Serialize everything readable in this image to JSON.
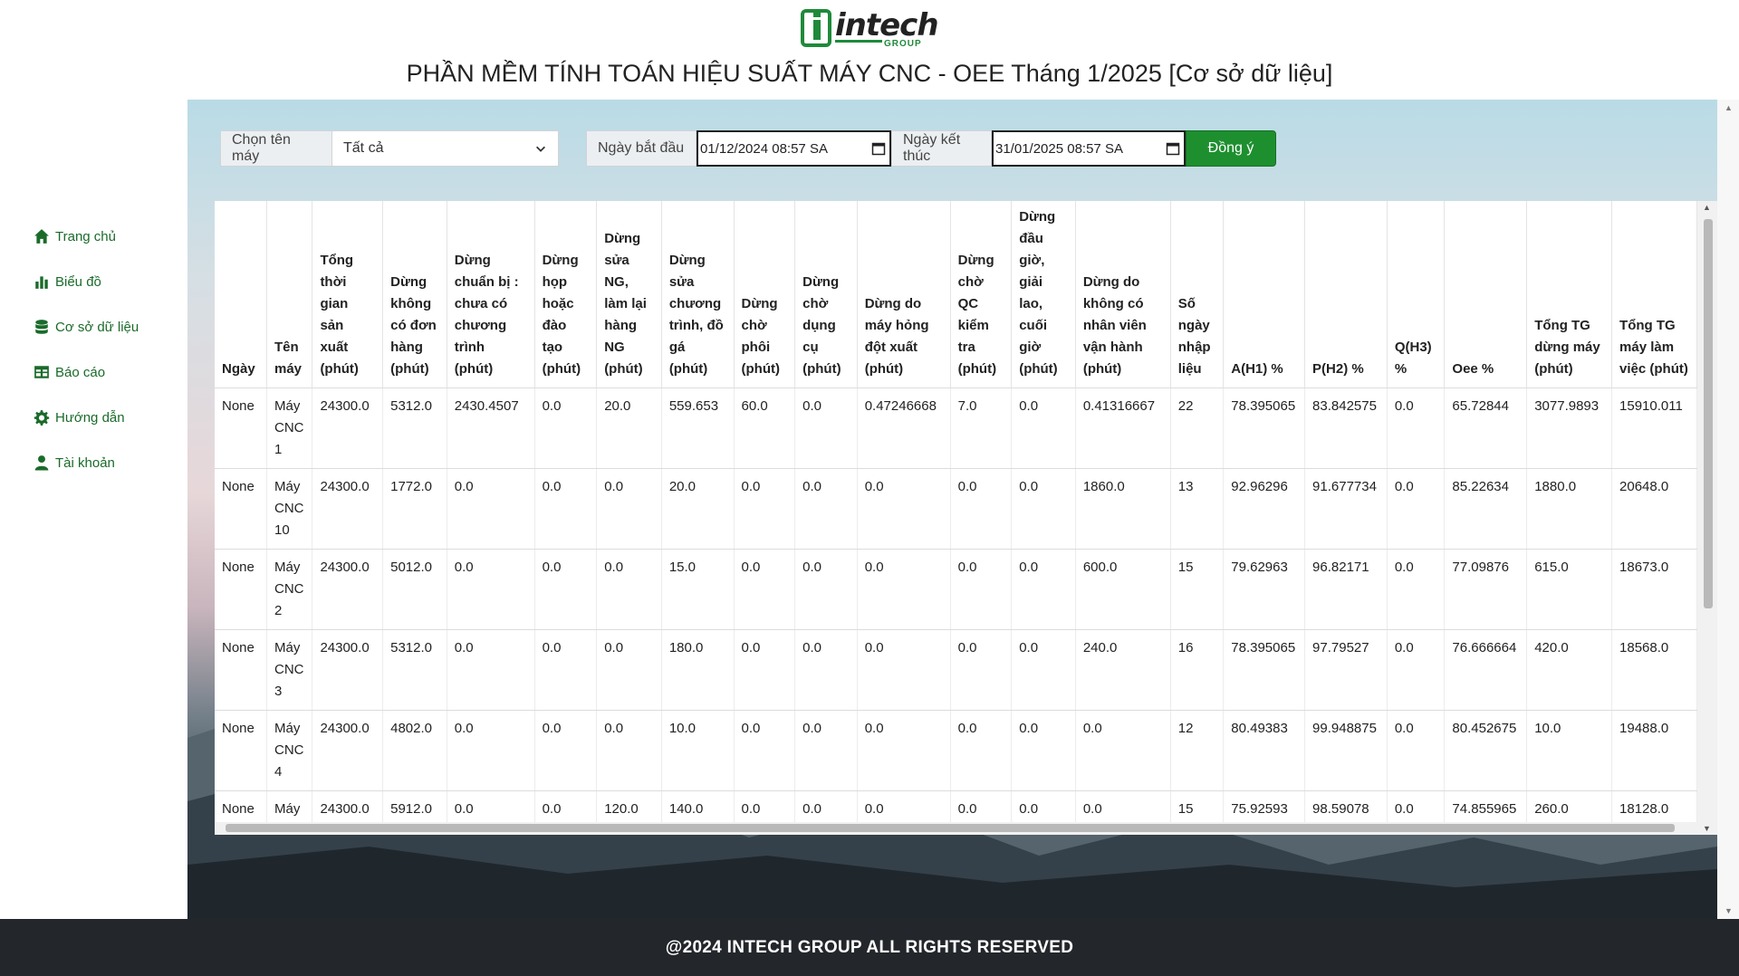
{
  "logo": {
    "text": "intech",
    "sub": "GROUP"
  },
  "page_title": "PHẦN MỀM TÍNH TOÁN HIỆU SUẤT MÁY CNC - OEE Tháng 1/2025 [Cơ sở dữ liệu]",
  "sidebar": {
    "items": [
      {
        "label": "Trang chủ",
        "icon": "home-icon"
      },
      {
        "label": "Biểu đồ",
        "icon": "bar-chart-icon"
      },
      {
        "label": "Cơ sở dữ liệu",
        "icon": "database-icon"
      },
      {
        "label": "Báo cáo",
        "icon": "table-icon"
      },
      {
        "label": "Hướng dẫn",
        "icon": "gear-icon"
      },
      {
        "label": "Tài khoản",
        "icon": "user-icon"
      }
    ]
  },
  "filters": {
    "machine_label": "Chọn tên máy",
    "machine_value": "Tất cả",
    "start_label": "Ngày bắt đầu",
    "start_value": "01/12/2024 08:57  SA",
    "end_label": "Ngày kết thúc",
    "end_value": "31/01/2025 08:57  SA",
    "submit_label": "Đồng ý"
  },
  "table": {
    "headers": [
      "Ngày",
      "Tên máy",
      "Tổng thời gian sản xuất (phút)",
      "Dừng không có đơn hàng (phút)",
      "Dừng chuẩn bị : chưa có chương trình (phút)",
      "Dừng họp hoặc đào tạo (phút)",
      "Dừng sửa NG, làm lại hàng NG (phút)",
      "Dừng sửa chương trình, đồ gá (phút)",
      "Dừng chờ phôi (phút)",
      "Dừng chờ dụng cụ (phút)",
      "Dừng do máy hỏng đột xuất (phút)",
      "Dừng chờ QC kiểm tra (phút)",
      "Dừng đầu giờ, giải lao, cuối giờ (phút)",
      "Dừng do không có nhân viên vận hành (phút)",
      "Số ngày nhập liệu",
      "A(H1) %",
      "P(H2) %",
      "Q(H3) %",
      "Oee %",
      "Tổng TG dừng máy (phút)",
      "Tổng TG máy làm việc (phút)"
    ],
    "rows": [
      [
        "None",
        "Máy CNC 1",
        "24300.0",
        "5312.0",
        "2430.4507",
        "0.0",
        "20.0",
        "559.653",
        "60.0",
        "0.0",
        "0.47246668",
        "7.0",
        "0.0",
        "0.41316667",
        "22",
        "78.395065",
        "83.842575",
        "0.0",
        "65.72844",
        "3077.9893",
        "15910.011"
      ],
      [
        "None",
        "Máy CNC 10",
        "24300.0",
        "1772.0",
        "0.0",
        "0.0",
        "0.0",
        "20.0",
        "0.0",
        "0.0",
        "0.0",
        "0.0",
        "0.0",
        "1860.0",
        "13",
        "92.96296",
        "91.677734",
        "0.0",
        "85.22634",
        "1880.0",
        "20648.0"
      ],
      [
        "None",
        "Máy CNC 2",
        "24300.0",
        "5012.0",
        "0.0",
        "0.0",
        "0.0",
        "15.0",
        "0.0",
        "0.0",
        "0.0",
        "0.0",
        "0.0",
        "600.0",
        "15",
        "79.62963",
        "96.82171",
        "0.0",
        "77.09876",
        "615.0",
        "18673.0"
      ],
      [
        "None",
        "Máy CNC 3",
        "24300.0",
        "5312.0",
        "0.0",
        "0.0",
        "0.0",
        "180.0",
        "0.0",
        "0.0",
        "0.0",
        "0.0",
        "0.0",
        "240.0",
        "16",
        "78.395065",
        "97.79527",
        "0.0",
        "76.666664",
        "420.0",
        "18568.0"
      ],
      [
        "None",
        "Máy CNC 4",
        "24300.0",
        "4802.0",
        "0.0",
        "0.0",
        "0.0",
        "10.0",
        "0.0",
        "0.0",
        "0.0",
        "0.0",
        "0.0",
        "0.0",
        "12",
        "80.49383",
        "99.948875",
        "0.0",
        "80.452675",
        "10.0",
        "19488.0"
      ],
      [
        "None",
        "Máy",
        "24300.0",
        "5912.0",
        "0.0",
        "0.0",
        "120.0",
        "140.0",
        "0.0",
        "0.0",
        "0.0",
        "0.0",
        "0.0",
        "0.0",
        "15",
        "75.92593",
        "98.59078",
        "0.0",
        "74.855965",
        "260.0",
        "18128.0"
      ]
    ]
  },
  "footer": "@2024 INTECH GROUP ALL RIGHTS RESERVED"
}
